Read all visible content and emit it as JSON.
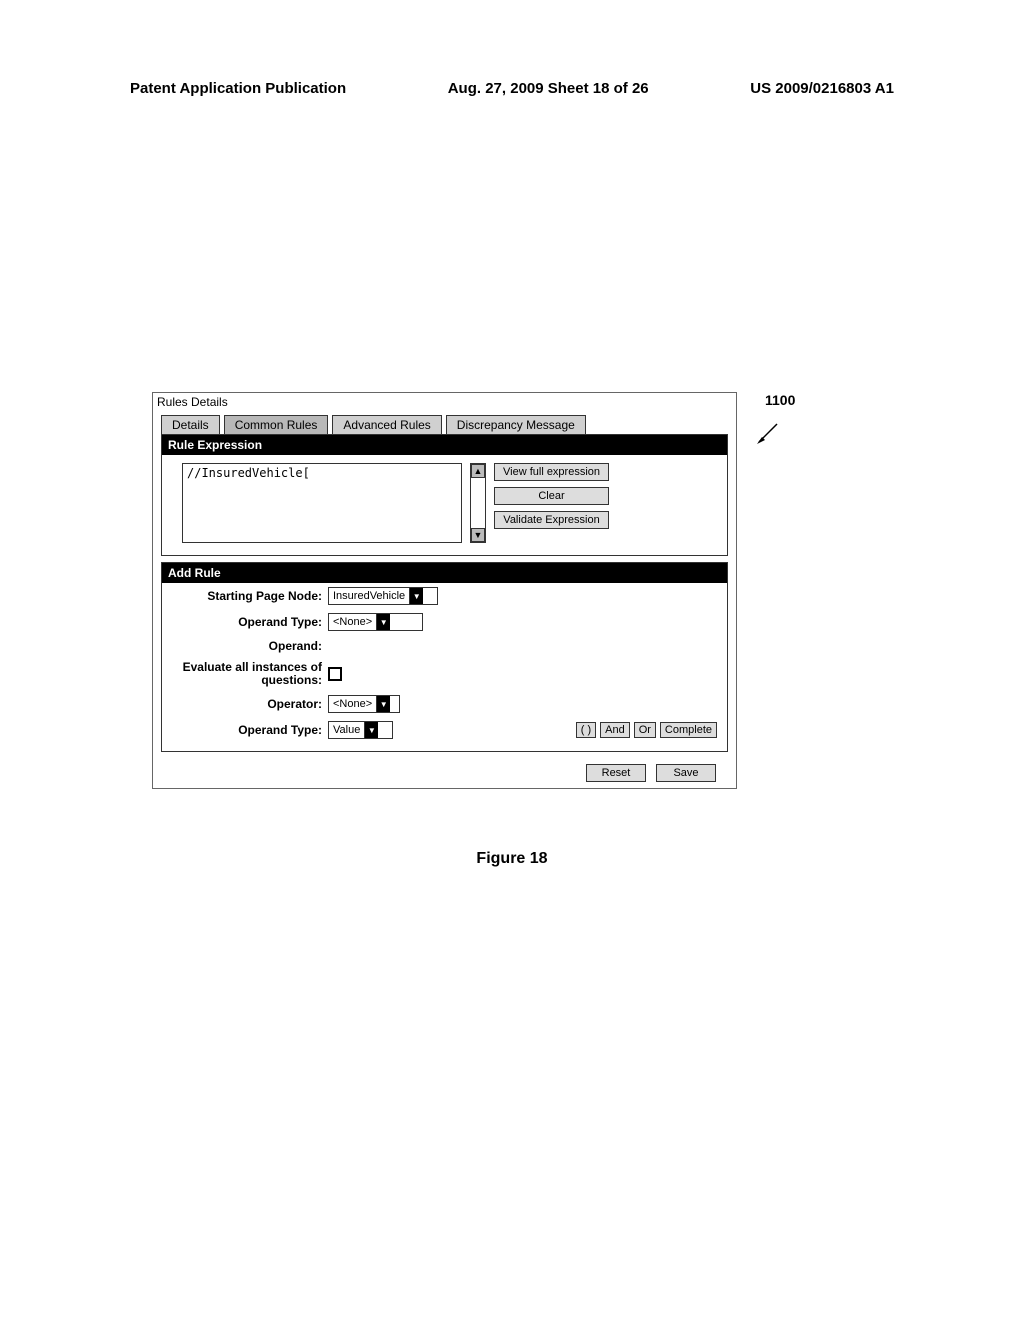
{
  "header": {
    "left": "Patent Application Publication",
    "center": "Aug. 27, 2009  Sheet 18 of 26",
    "right": "US 2009/0216803 A1"
  },
  "panel": {
    "title": "Rules Details",
    "tabs": [
      "Details",
      "Common Rules",
      "Advanced Rules",
      "Discrepancy Message"
    ],
    "active_tab_index": 1
  },
  "rule_expression": {
    "header": "Rule Expression",
    "value": "//InsuredVehicle[",
    "buttons": {
      "view": "View full expression",
      "clear": "Clear",
      "validate": "Validate Expression"
    }
  },
  "add_rule": {
    "header": "Add Rule",
    "fields": {
      "starting_page_node": {
        "label": "Starting Page Node:",
        "value": "InsuredVehicle"
      },
      "operand_type_1": {
        "label": "Operand Type:",
        "value": "<None>"
      },
      "operand": {
        "label": "Operand:"
      },
      "evaluate_all": {
        "label": "Evaluate all instances of questions:",
        "checked": false
      },
      "operator": {
        "label": "Operator:",
        "value": "<None>"
      },
      "operand_type_2": {
        "label": "Operand Type:",
        "value": "Value"
      }
    },
    "inline_buttons": {
      "paren": "( )",
      "and": "And",
      "or": "Or",
      "complete": "Complete"
    }
  },
  "footer": {
    "reset": "Reset",
    "save": "Save"
  },
  "reference": {
    "number": "1100"
  },
  "figure_caption": "Figure 18"
}
